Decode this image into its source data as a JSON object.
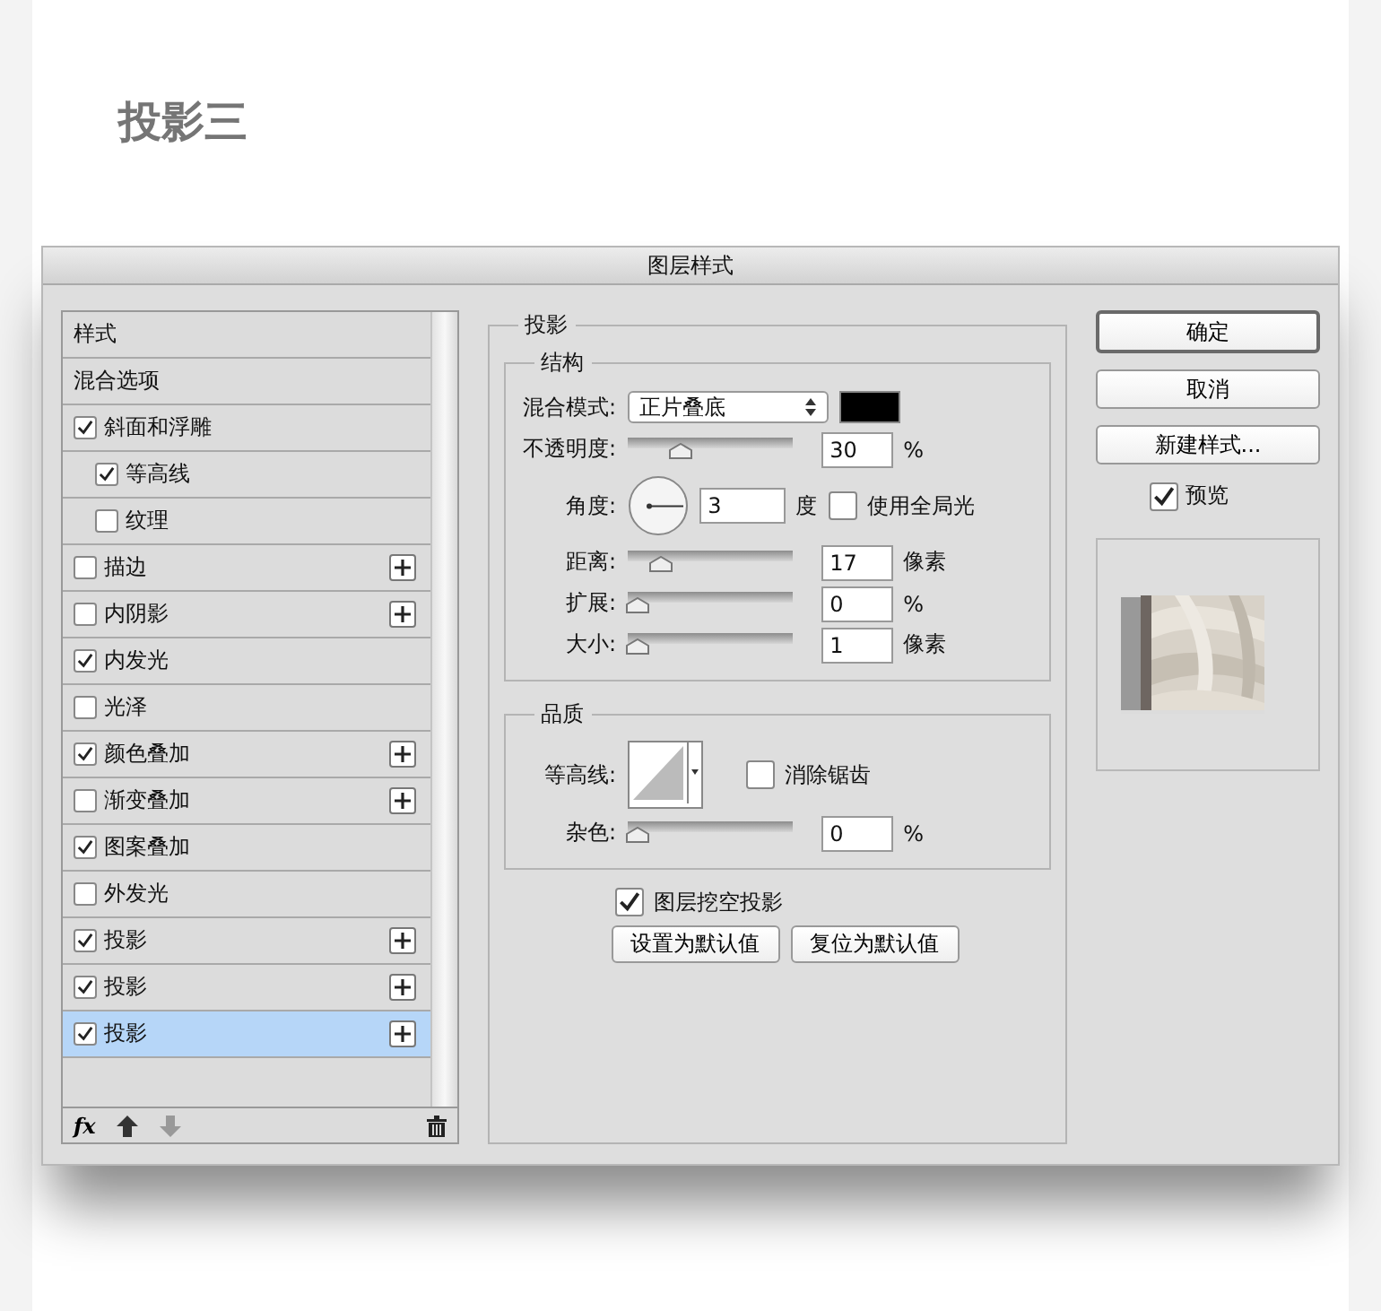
{
  "page_title": "投影三",
  "dialog": {
    "title": "图层样式"
  },
  "style_list": {
    "items": [
      {
        "label": "样式",
        "kind": "header",
        "selected": false
      },
      {
        "label": "混合选项",
        "kind": "header",
        "selected": false
      },
      {
        "label": "斜面和浮雕",
        "kind": "effect",
        "checked": true,
        "addable": false,
        "selected": false,
        "children": [
          {
            "label": "等高线",
            "kind": "effect",
            "checked": true,
            "addable": false,
            "selected": false
          },
          {
            "label": "纹理",
            "kind": "effect",
            "checked": false,
            "addable": false,
            "selected": false
          }
        ]
      },
      {
        "label": "描边",
        "kind": "effect",
        "checked": false,
        "addable": true,
        "selected": false
      },
      {
        "label": "内阴影",
        "kind": "effect",
        "checked": false,
        "addable": true,
        "selected": false
      },
      {
        "label": "内发光",
        "kind": "effect",
        "checked": true,
        "addable": false,
        "selected": false
      },
      {
        "label": "光泽",
        "kind": "effect",
        "checked": false,
        "addable": false,
        "selected": false
      },
      {
        "label": "颜色叠加",
        "kind": "effect",
        "checked": true,
        "addable": true,
        "selected": false
      },
      {
        "label": "渐变叠加",
        "kind": "effect",
        "checked": false,
        "addable": true,
        "selected": false
      },
      {
        "label": "图案叠加",
        "kind": "effect",
        "checked": true,
        "addable": false,
        "selected": false
      },
      {
        "label": "外发光",
        "kind": "effect",
        "checked": false,
        "addable": false,
        "selected": false
      },
      {
        "label": "投影",
        "kind": "effect",
        "checked": true,
        "addable": true,
        "selected": false
      },
      {
        "label": "投影",
        "kind": "effect",
        "checked": true,
        "addable": true,
        "selected": false
      },
      {
        "label": "投影",
        "kind": "effect",
        "checked": true,
        "addable": true,
        "selected": true
      }
    ],
    "footer": {
      "fx_label": "fx",
      "move_down_disabled": true
    }
  },
  "settings": {
    "title": "投影",
    "structure": {
      "title": "结构",
      "blend_label": "混合模式:",
      "blend_mode": "正片叠底",
      "color": "#000000",
      "rows": [
        {
          "kind": "slider",
          "label": "不透明度:",
          "level": 0.3,
          "value": "30",
          "unit": "%"
        },
        {
          "kind": "angle",
          "label": "角度:",
          "value": "3",
          "unit": "度",
          "checkbox_label": "使用全局光",
          "checked": false
        },
        {
          "kind": "slider",
          "label": "距离:",
          "level": 0.17,
          "value": "17",
          "unit": "像素"
        },
        {
          "kind": "slider",
          "label": "扩展:",
          "level": 0,
          "value": "0",
          "unit": "%"
        },
        {
          "kind": "slider",
          "label": "大小:",
          "level": 0.01,
          "value": "1",
          "unit": "像素"
        }
      ]
    },
    "quality": {
      "title": "品质",
      "contour_label": "等高线:",
      "antialias_label": "消除锯齿",
      "antialias": false,
      "noise": {
        "label": "杂色:",
        "level": 0,
        "value": "0",
        "unit": "%"
      }
    },
    "knockout": {
      "label": "图层挖空投影",
      "checked": true
    },
    "buttons": [
      "设置为默认值",
      "复位为默认值"
    ]
  },
  "actions": {
    "buttons": [
      {
        "label": "确定",
        "default": true
      },
      {
        "label": "取消",
        "default": false
      },
      {
        "label": "新建样式...",
        "default": false
      }
    ],
    "preview": {
      "label": "预览",
      "checked": true
    }
  }
}
